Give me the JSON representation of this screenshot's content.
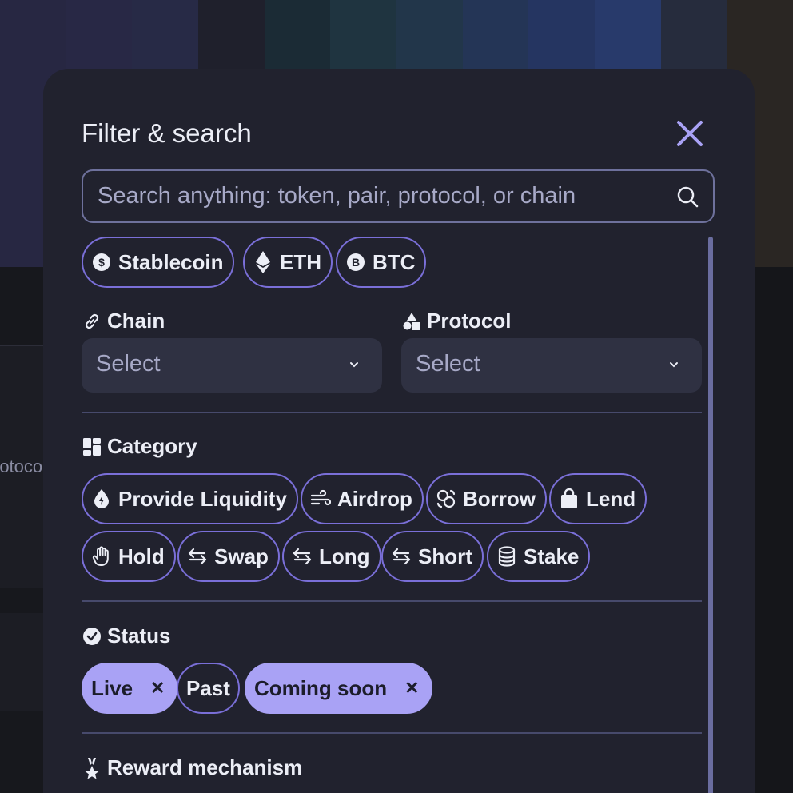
{
  "background": {
    "banner_colors": [
      "#272742",
      "#282845",
      "#272a46",
      "#1f202c",
      "#1b2b35",
      "#1f3440",
      "#22364a",
      "#243556",
      "#253561",
      "#283a6b",
      "#262c3d",
      "#2a2623"
    ],
    "partial_text": "rotocol"
  },
  "modal": {
    "title": "Filter & search",
    "search": {
      "placeholder": "Search anything: token, pair, protocol, or chain"
    },
    "token_chips": [
      {
        "label": "Stablecoin",
        "icon": "stablecoin-icon"
      },
      {
        "label": "ETH",
        "icon": "eth-icon"
      },
      {
        "label": "BTC",
        "icon": "btc-icon"
      }
    ],
    "chain": {
      "label": "Chain",
      "icon": "link-icon",
      "value": "Select"
    },
    "protocol": {
      "label": "Protocol",
      "icon": "shapes-icon",
      "value": "Select"
    },
    "category": {
      "label": "Category",
      "icon": "dashboard-icon",
      "items": [
        {
          "label": "Provide Liquidity",
          "icon": "drop-bolt-icon"
        },
        {
          "label": "Airdrop",
          "icon": "wind-icon"
        },
        {
          "label": "Borrow",
          "icon": "exchange-circles-icon"
        },
        {
          "label": "Lend",
          "icon": "bag-icon"
        },
        {
          "label": "Hold",
          "icon": "hand-icon"
        },
        {
          "label": "Swap",
          "icon": "swap-arrows-icon"
        },
        {
          "label": "Long",
          "icon": "swap-arrows-icon"
        },
        {
          "label": "Short",
          "icon": "swap-arrows-icon"
        },
        {
          "label": "Stake",
          "icon": "database-icon"
        }
      ]
    },
    "status": {
      "label": "Status",
      "icon": "check-circle-icon",
      "items": [
        {
          "label": "Live",
          "selected": true,
          "remove": "✕"
        },
        {
          "label": "Past",
          "selected": false
        },
        {
          "label": "Coming soon",
          "selected": true,
          "remove": "✕"
        }
      ]
    },
    "reward": {
      "label": "Reward mechanism",
      "icon": "medal-icon"
    }
  },
  "colors": {
    "accent": "#7a6fd8",
    "selected_chip": "#a9a2f5",
    "modal_bg": "#21222e",
    "close_icon": "#a9a2f5"
  }
}
